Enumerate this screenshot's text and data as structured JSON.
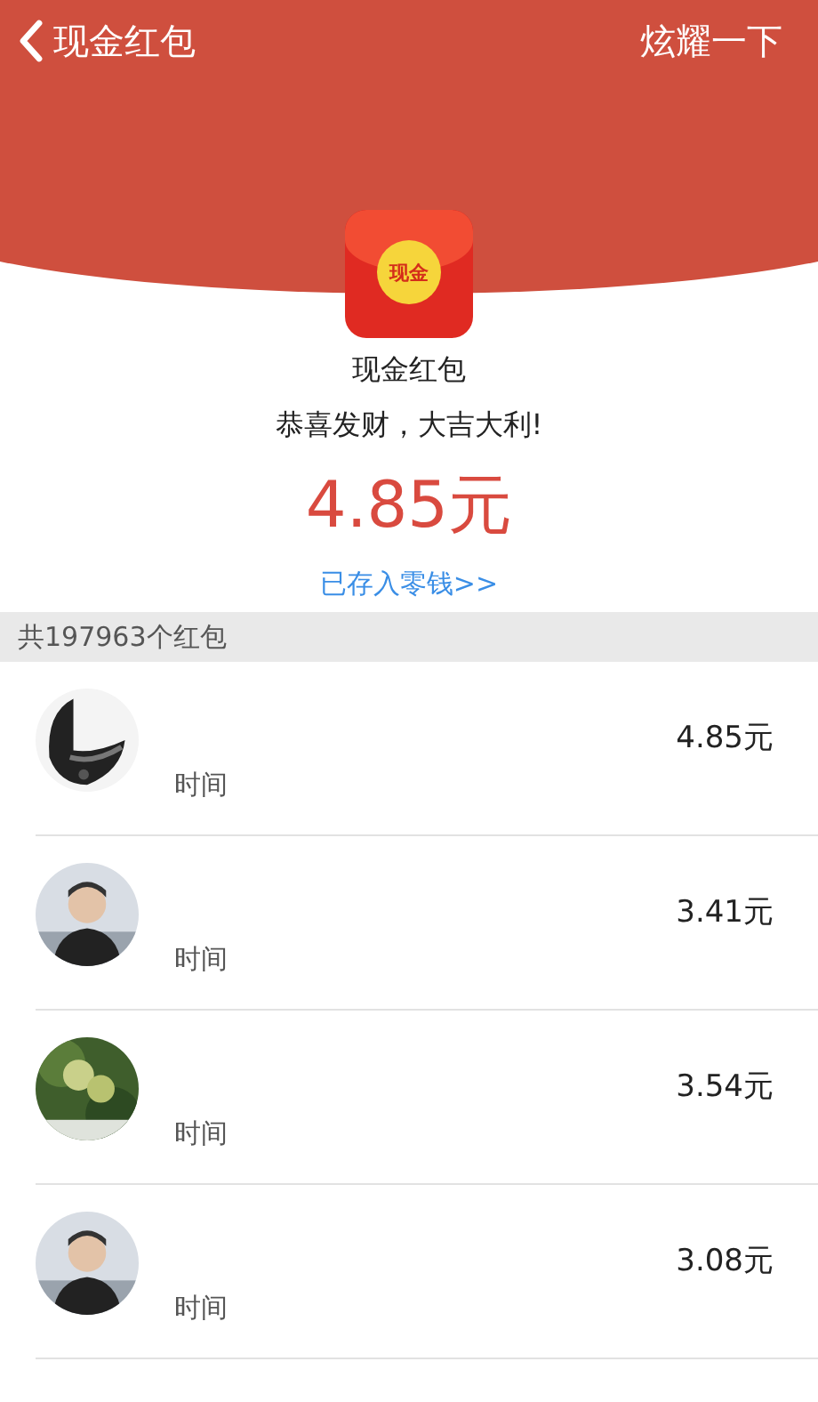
{
  "nav": {
    "back_label": "现金红包",
    "action": "炫耀一下"
  },
  "packet": {
    "badge": "现金",
    "title": "现金红包",
    "wish": "恭喜发财，大吉大利!",
    "amount": "4.85元",
    "link": "已存入零钱>>"
  },
  "summary": "共197963个红包",
  "records": [
    {
      "kind": "picture",
      "time_label": "时间",
      "amount": "4.85元"
    },
    {
      "time_label": "时间",
      "amount": "3.41元"
    },
    {
      "time_label": "时间",
      "amount": "3.54元"
    },
    {
      "time_label": "时间",
      "amount": "3.08元"
    }
  ]
}
